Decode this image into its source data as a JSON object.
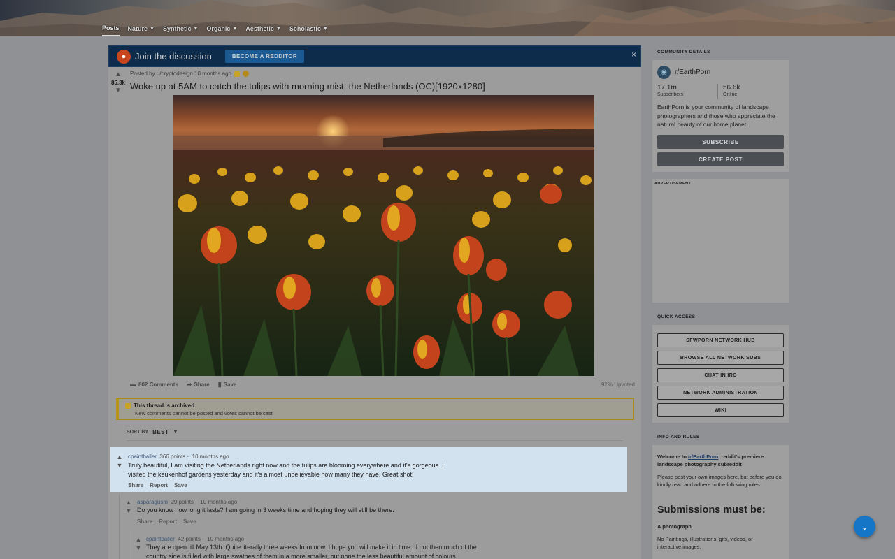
{
  "nav": {
    "items": [
      {
        "label": "Posts",
        "active": true
      },
      {
        "label": "Nature"
      },
      {
        "label": "Synthetic"
      },
      {
        "label": "Organic"
      },
      {
        "label": "Aesthetic"
      },
      {
        "label": "Scholastic"
      }
    ]
  },
  "joinbar": {
    "title": "Join the discussion",
    "button": "BECOME A REDDITOR",
    "close": "×"
  },
  "post": {
    "score": "85.3k",
    "meta": "Posted by u/cryptodesign 10 months ago",
    "title": "Woke up at 5AM to catch the tulips with morning mist, the Netherlands (OC)[1920x1280]",
    "comments": "802 Comments",
    "share": "Share",
    "save": "Save",
    "upvoted": "92% Upvoted"
  },
  "archived": {
    "title": "This thread is archived",
    "subtitle": "New comments cannot be posted and votes cannot be cast"
  },
  "sort": {
    "label": "SORT BY",
    "value": "BEST"
  },
  "comments": [
    {
      "user": "cpaintballer",
      "points": "366 points",
      "time": "10 months ago",
      "line1": "Truly beautiful, I am visiting the Netherlands right now and the tulips are blooming everywhere and it's gorgeous. I",
      "line2": "visited the keukenhof gardens yesterday and it's almost unbelievable how many they have. Great shot!",
      "actions": [
        "Share",
        "Report",
        "Save"
      ]
    },
    {
      "user": "asparagusm",
      "points": "29 points",
      "time": "10 months ago",
      "line1": "Do you know how long it lasts? I am going in 3 weeks time and hoping they will still be there.",
      "actions": [
        "Share",
        "Report",
        "Save"
      ]
    },
    {
      "user": "cpaintballer",
      "points": "42 points",
      "time": "10 months ago",
      "line1": "They are open till May 13th. Quite literally three weeks from now. I hope you will make it in time. If not then much of the",
      "line2": "country side is filled with large swathes of them in a more smaller, but none the less beautiful amount of colours."
    }
  ],
  "sidebar": {
    "community_header": "COMMUNITY DETAILS",
    "community_name": "r/EarthPorn",
    "subscribers_value": "17.1m",
    "subscribers_label": "Subscribers",
    "online_value": "56.6k",
    "online_label": "Online",
    "description": "EarthPorn is your community of landscape photographers and those who appreciate the natural beauty of our home planet.",
    "subscribe": "SUBSCRIBE",
    "create_post": "CREATE POST",
    "advertisement": "ADVERTISEMENT",
    "quick_access_header": "QUICK ACCESS",
    "quick_links": [
      "SFWPORN NETWORK HUB",
      "BROWSE ALL NETWORK SUBS",
      "CHAT IN IRC",
      "NETWORK ADMINISTRATION",
      "WIKI"
    ],
    "rules_header": "INFO AND RULES",
    "rules_welcome_bold": "Welcome to",
    "rules_link": "/r/EarthPorn",
    "rules_welcome_rest": ", reddit's premiere landscape photography subreddit",
    "rules_intro": "Please post your own images here, but before you do, kindly read and adhere to the following rules:",
    "rules_heading": "Submissions must be:",
    "rule1_title": "A photograph",
    "rule1_text": "No Paintings, illustrations, gifs, videos, or interactive images."
  },
  "colors": {
    "accent": "#1576c8",
    "join_bar": "#0d2b4a",
    "archived_border": "#b8931a",
    "highlight_comment": "#d3e2ef"
  }
}
